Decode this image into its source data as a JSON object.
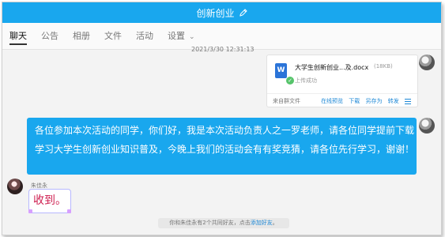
{
  "window": {
    "title": "创新创业"
  },
  "tabs": [
    {
      "label": "聊天"
    },
    {
      "label": "公告"
    },
    {
      "label": "相册"
    },
    {
      "label": "文件"
    },
    {
      "label": "活动"
    },
    {
      "label": "设置"
    }
  ],
  "chat": {
    "timestamp": "2021/3/30 12:31:13",
    "file_message": {
      "file_name": "大学生创新创业...及.docx",
      "file_size": "(18KB)",
      "status": "上传成功",
      "source": "来自群文件",
      "actions": [
        "在线预览",
        "下载",
        "另存为",
        "转发"
      ]
    },
    "teacher_message": "各位参加本次活动的同学，你们好，我是本次活动负责人之一罗老师，请各位同学提前下载学习大学生创新创业知识普及，今晚上我们的活动会有有奖竞猜，请各位先行学习，谢谢！",
    "reply": {
      "sender": "朱佳永",
      "text": "收到。"
    },
    "notice": {
      "prefix": "你和朱佳永有2个共同好友，点击",
      "link": "添加好友",
      "suffix": "。"
    }
  },
  "icons": {
    "edit": "pencil-icon",
    "file": "word-document-icon",
    "success": "check-circle-icon",
    "more": "menu-icon"
  },
  "colors": {
    "accent": "#19a7ee",
    "reply_text": "#ce1f50"
  }
}
